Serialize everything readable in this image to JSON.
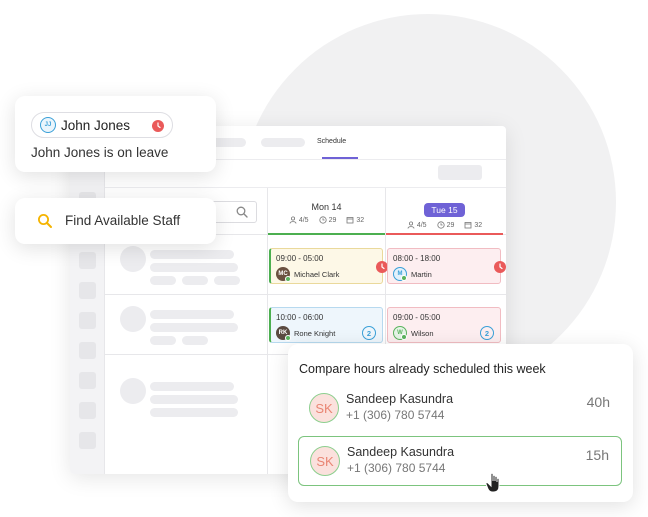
{
  "leave_card": {
    "chip_initials": "JJ",
    "chip_name": "John Jones",
    "message": "John Jones is on leave"
  },
  "find_card": {
    "label": "Find Available Staff"
  },
  "app": {
    "tab_schedule": "Schedule",
    "days": [
      {
        "label": "Mon 14",
        "staff": "4/5",
        "hours": "29",
        "shifts": "32",
        "bar_color": "#4caf50"
      },
      {
        "label": "Tue 15",
        "staff": "4/5",
        "hours": "29",
        "shifts": "32",
        "bar_color": "#ea5a5a"
      }
    ],
    "shifts": [
      {
        "time": "09:00 - 05:00",
        "name": "Michael Clark",
        "initials": "MC"
      },
      {
        "time": "08:00 - 18:00",
        "name": "Martin",
        "initials": "M"
      },
      {
        "time": "10:00 - 06:00",
        "name": "Rone Knight",
        "initials": "RK",
        "count": "2"
      },
      {
        "time": "09:00 - 05:00",
        "name": "Wilson",
        "initials": "W",
        "count": "2"
      }
    ]
  },
  "compare_card": {
    "title": "Compare hours already scheduled this week",
    "staff": [
      {
        "initials": "SK",
        "name": "Sandeep Kasundra",
        "phone": "+1 (306) 780 5744",
        "hours": "40h"
      },
      {
        "initials": "SK",
        "name": "Sandeep Kasundra",
        "phone": "+1 (306) 780 5744",
        "hours": "15h"
      }
    ]
  },
  "colors": {
    "accent": "#6f62d6",
    "leave": "#ea5a5a",
    "available": "#5ab35d",
    "info": "#3aa0d8"
  },
  "icons": [
    "clock-icon",
    "search-icon",
    "magnifier-icon",
    "people-icon",
    "calendar-icon",
    "hand-cursor-icon"
  ]
}
